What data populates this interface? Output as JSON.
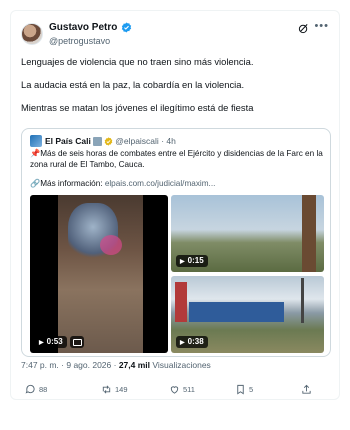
{
  "post": {
    "author_name": "Gustavo Petro",
    "author_handle": "@petrogustavo",
    "lines": [
      "Lenguajes de violencia que no traen sino más violencia.",
      "La audacia está en la paz, la cobardía en la violencia.",
      "Mientras se matan los jóvenes el ilegítimo está de fiesta"
    ]
  },
  "quote": {
    "author_name": "El País Cali",
    "author_handle": "@elpaiscali",
    "time": "· 4h",
    "text": "Más de seis horas de combates entre el Ejército y disidencias de la Farc en la zona rural de El Tambo, Cauca.",
    "link_prefix": "🔗Más información: ",
    "link": "elpais.com.co/judicial/maxim...",
    "videos": [
      {
        "duration": "0:53"
      },
      {
        "duration": "0:15"
      },
      {
        "duration": "0:38"
      }
    ]
  },
  "meta": {
    "time_date": "7:47 p. m. · 9 ago. 2026 · ",
    "views_count": "27,4 mil",
    "views_label": " Visualizaciones"
  },
  "actions": {
    "replies": "88",
    "reposts": "149",
    "likes": "511",
    "bookmarks": "5"
  },
  "colors": {
    "verified": "#1d9bf0",
    "pin": "#d0244a",
    "muted": "#536471"
  },
  "icons": [
    "grok-icon",
    "more-icon",
    "reply-icon",
    "repost-icon",
    "like-icon",
    "bookmark-icon",
    "share-icon",
    "play-icon",
    "gif-icon"
  ]
}
